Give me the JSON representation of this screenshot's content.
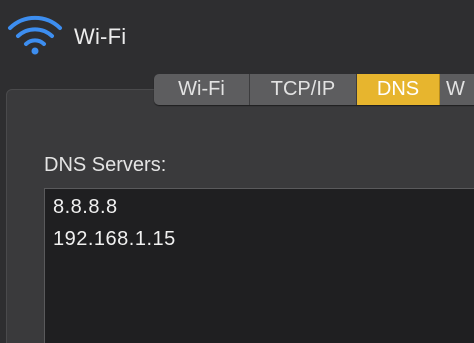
{
  "header": {
    "title": "Wi-Fi",
    "icon": "wifi-icon"
  },
  "tabs": [
    {
      "label": "Wi-Fi",
      "selected": false
    },
    {
      "label": "TCP/IP",
      "selected": false
    },
    {
      "label": "DNS",
      "selected": true
    },
    {
      "label": "W",
      "selected": false
    }
  ],
  "dns": {
    "label": "DNS Servers:",
    "servers": [
      "8.8.8.8",
      "192.168.1.15"
    ]
  },
  "colors": {
    "accent": "#e7b52e",
    "wifi_icon": "#3d8ef0",
    "background": "#2e2e30"
  }
}
